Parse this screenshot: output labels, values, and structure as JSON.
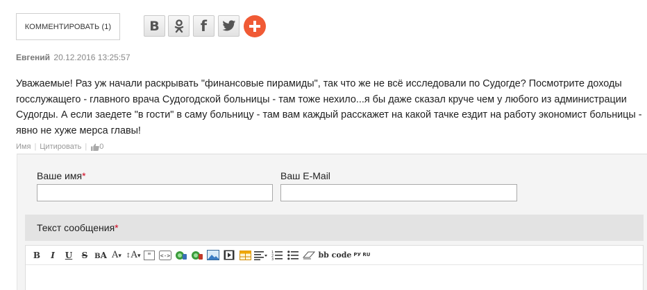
{
  "comment_button": {
    "label": "КОММЕНТИРОВАТЬ (1)"
  },
  "share": {
    "buttons": [
      {
        "name": "vkontakte",
        "glyph": "B"
      },
      {
        "name": "odnoklassniki",
        "glyph": "ok"
      },
      {
        "name": "facebook",
        "glyph": "f"
      },
      {
        "name": "twitter",
        "glyph": "bird"
      },
      {
        "name": "more",
        "glyph": "+"
      }
    ],
    "plus_color": "#f05a35"
  },
  "comment": {
    "author": "Евгений",
    "date": "20.12.2016 13:25:57",
    "text": "Уважаемые! Раз уж начали раскрывать \"финансовые пирамиды\", так что же не всё исследовали по Судогде? Посмотрите доходы госслужащего - главного врача Судогодской больницы - там тоже нехило...я бы даже сказал круче чем у любого из администрации Судогды. А если заедете \"в гости\" в саму больницу - там вам каждый расскажет на какой тачке ездит на работу экономист больницы - явно не хуже мерса главы!",
    "actions": {
      "name": "Имя",
      "quote": "Цитировать",
      "likes": "0"
    }
  },
  "form": {
    "name_label": "Ваше имя",
    "email_label": "Ваш E-Mail",
    "message_label": "Текст сообщения",
    "required_mark": "*",
    "name_value": "",
    "email_value": ""
  },
  "toolbar": {
    "buttons": [
      "bold",
      "italic",
      "underline",
      "strikethrough",
      "font-color",
      "font-size",
      "font-family",
      "quote",
      "code",
      "link",
      "unlink",
      "image",
      "video",
      "table",
      "align",
      "ordered-list",
      "unordered-list",
      "eraser",
      "bbcode",
      "translit"
    ],
    "bbcode_label": "bb code",
    "translit_label": "РУ RU"
  }
}
